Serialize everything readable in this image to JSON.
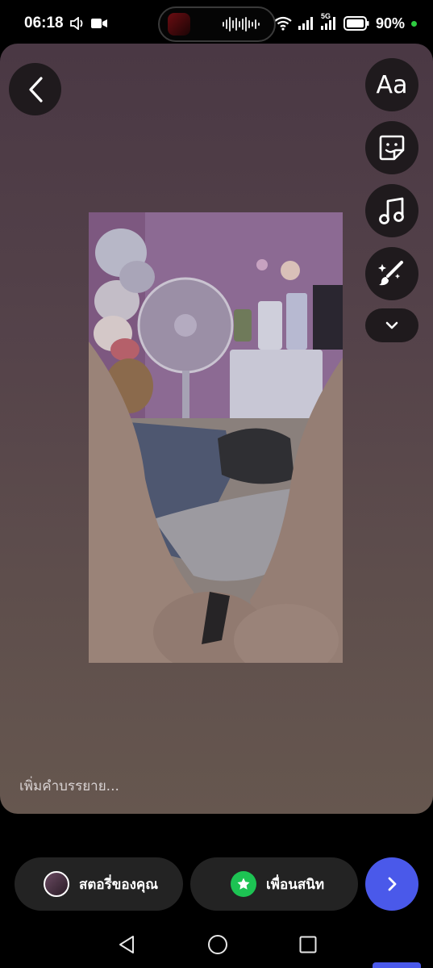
{
  "status_bar": {
    "time": "06:18",
    "battery_percent": "90%",
    "network": "5G"
  },
  "tools": {
    "text_label": "Aa"
  },
  "caption": {
    "placeholder": "เพิ่มคำบรรยาย..."
  },
  "share": {
    "your_story_label": "สตอรี่ของคุณ",
    "close_friends_label": "เพื่อนสนิท"
  },
  "colors": {
    "accent": "#4a59ea",
    "close_friends_green": "#1dc353"
  }
}
